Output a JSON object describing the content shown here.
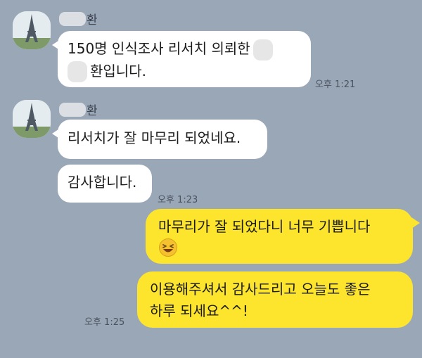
{
  "messages": [
    {
      "sender_suffix": "환",
      "line1": "150명 인식조사 리서치 의뢰한",
      "line2": "환입니다.",
      "time": "오후 1:21"
    },
    {
      "sender_suffix": "환",
      "text": "리서치가 잘 마무리 되었네요."
    },
    {
      "text": "감사합니다.",
      "time": "오후 1:23"
    },
    {
      "text": "마무리가 잘 되었다니 너무 기쁩니다",
      "emoji": "laughing-emoji-icon"
    },
    {
      "line1": "이용해주셔서 감사드리고 오늘도 좋은",
      "line2": "하루 되세요^^!",
      "time": "오후 1:25"
    }
  ],
  "colors": {
    "background": "#9aa7b7",
    "received_bubble": "#ffffff",
    "sent_bubble": "#fde52d"
  }
}
